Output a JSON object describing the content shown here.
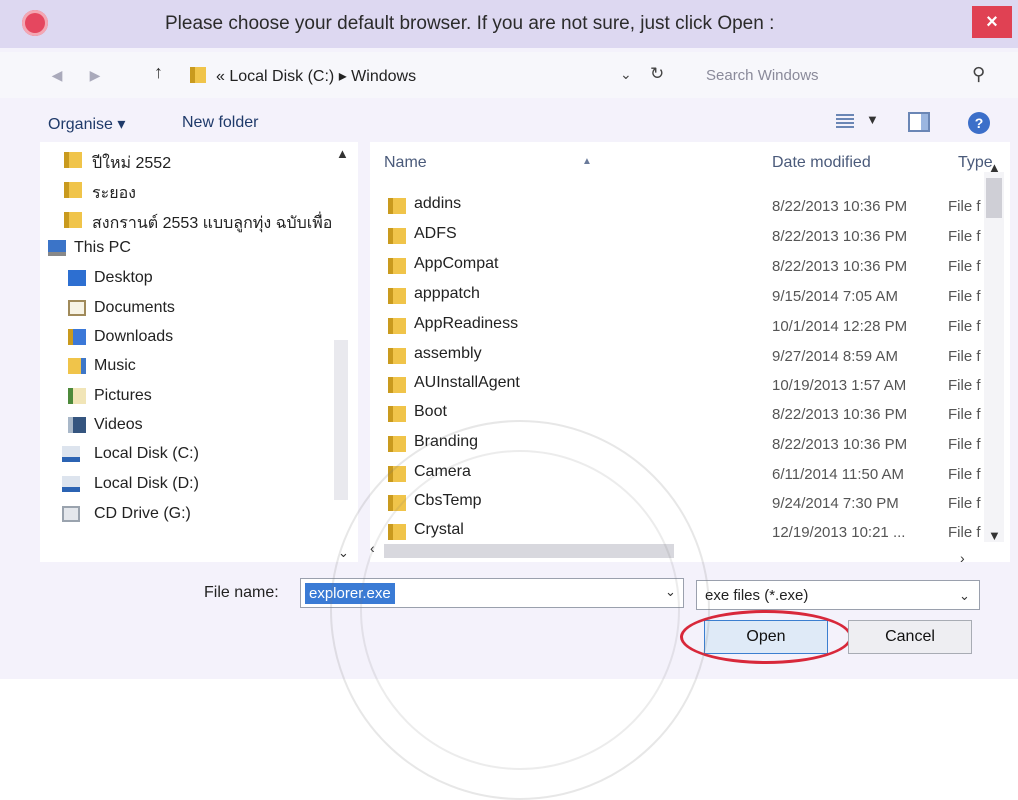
{
  "window": {
    "title": "Please choose your default browser. If you are not sure, just click Open :",
    "close_label": "×"
  },
  "address": {
    "path": "« Local Disk (C:)  ▸  Windows",
    "search_placeholder": "Search Windows"
  },
  "toolbar": {
    "organise": "Organise ▾",
    "new_folder": "New folder"
  },
  "nav": {
    "items": [
      {
        "label": "ปีใหม่ 2552",
        "icon": "folder-icon"
      },
      {
        "label": "ระยอง",
        "icon": "folder-icon"
      },
      {
        "label": "สงกรานต์ 2553 แบบลูกทุ่ง ฉบับเพื่อ",
        "icon": "folder-icon"
      },
      {
        "label": "This PC",
        "icon": "computer-icon"
      },
      {
        "label": "Desktop",
        "icon": "desktop-icon"
      },
      {
        "label": "Documents",
        "icon": "documents-icon"
      },
      {
        "label": "Downloads",
        "icon": "downloads-icon"
      },
      {
        "label": "Music",
        "icon": "music-icon"
      },
      {
        "label": "Pictures",
        "icon": "pictures-icon"
      },
      {
        "label": "Videos",
        "icon": "videos-icon"
      },
      {
        "label": "Local Disk (C:)",
        "icon": "local-disk-icon"
      },
      {
        "label": "Local Disk (D:)",
        "icon": "local-disk-icon"
      },
      {
        "label": "CD Drive (G:)",
        "icon": "cd-drive-icon"
      }
    ]
  },
  "list": {
    "columns": {
      "name": "Name",
      "date": "Date modified",
      "type": "Type"
    },
    "rows": [
      {
        "name": "addins",
        "date": "8/22/2013 10:36 PM",
        "type": "File f"
      },
      {
        "name": "ADFS",
        "date": "8/22/2013 10:36 PM",
        "type": "File f"
      },
      {
        "name": "AppCompat",
        "date": "8/22/2013 10:36 PM",
        "type": "File f"
      },
      {
        "name": "apppatch",
        "date": "9/15/2014 7:05 AM",
        "type": "File f"
      },
      {
        "name": "AppReadiness",
        "date": "10/1/2014 12:28 PM",
        "type": "File f"
      },
      {
        "name": "assembly",
        "date": "9/27/2014 8:59 AM",
        "type": "File f"
      },
      {
        "name": "AUInstallAgent",
        "date": "10/19/2013 1:57 AM",
        "type": "File f"
      },
      {
        "name": "Boot",
        "date": "8/22/2013 10:36 PM",
        "type": "File f"
      },
      {
        "name": "Branding",
        "date": "8/22/2013 10:36 PM",
        "type": "File f"
      },
      {
        "name": "Camera",
        "date": "6/11/2014 11:50 AM",
        "type": "File f"
      },
      {
        "name": "CbsTemp",
        "date": "9/24/2014 7:30 PM",
        "type": "File f"
      },
      {
        "name": "Crystal",
        "date": "12/19/2013 10:21 ...",
        "type": "File f"
      }
    ]
  },
  "footer": {
    "filename_label": "File name:",
    "filename_value": "explorer.exe",
    "filter_value": "exe files (*.exe)",
    "open_label": "Open",
    "cancel_label": "Cancel"
  },
  "colors": {
    "titlebar": "#ddd8f1",
    "close": "#e04153",
    "highlight_circle": "#d8283a",
    "selection": "#3a7bd5"
  }
}
